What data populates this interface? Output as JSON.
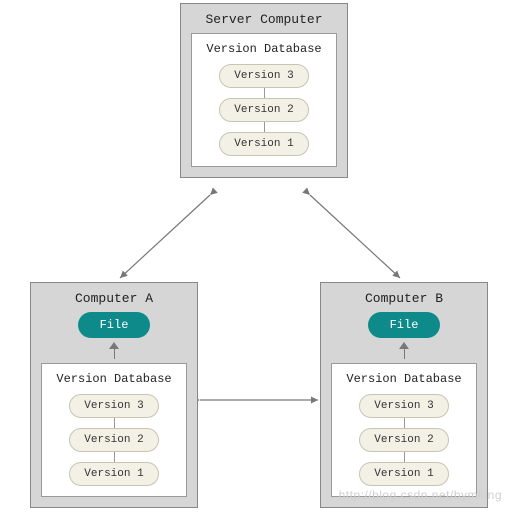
{
  "server": {
    "title": "Server Computer",
    "db_label": "Version Database",
    "versions": [
      "Version 3",
      "Version 2",
      "Version 1"
    ]
  },
  "computerA": {
    "title": "Computer A",
    "file_label": "File",
    "db_label": "Version Database",
    "versions": [
      "Version 3",
      "Version 2",
      "Version 1"
    ]
  },
  "computerB": {
    "title": "Computer B",
    "file_label": "File",
    "db_label": "Version Database",
    "versions": [
      "Version 3",
      "Version 2",
      "Version 1"
    ]
  },
  "watermark": "http://blog.csdn.net/bymking"
}
